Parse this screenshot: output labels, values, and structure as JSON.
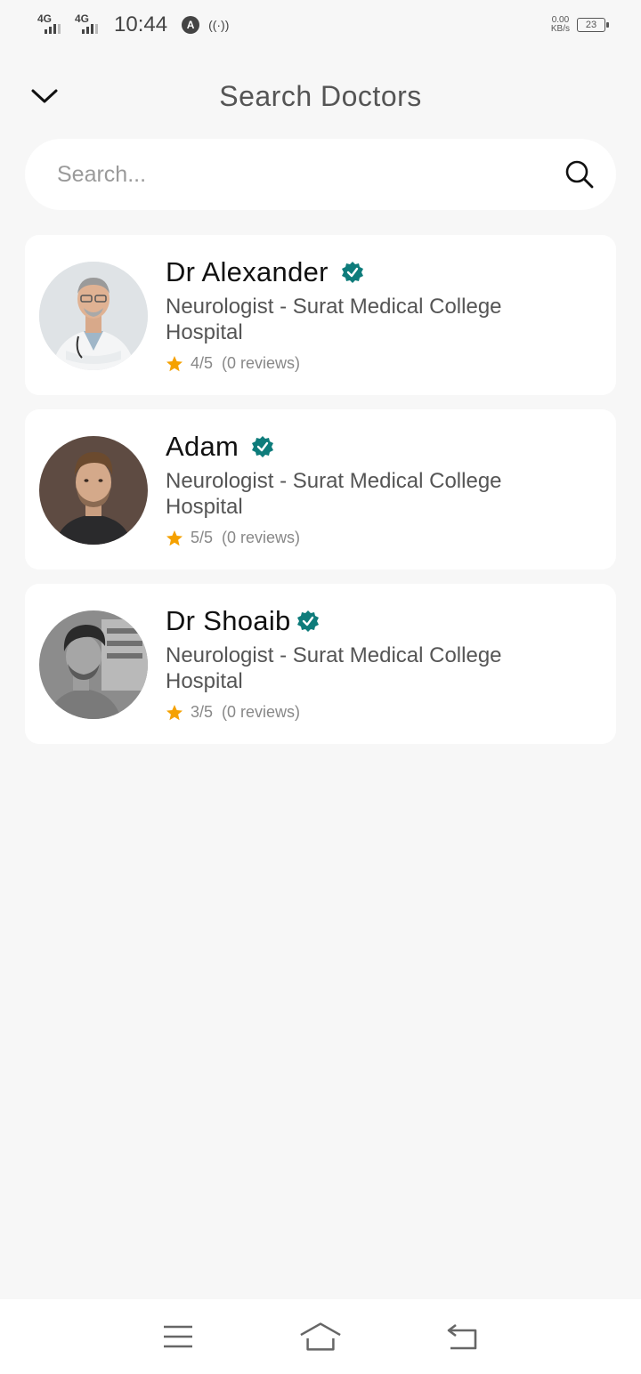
{
  "status_bar": {
    "network_1": "4G",
    "network_2": "4G",
    "time": "10:44",
    "speed_value": "0.00",
    "speed_unit": "KB/s",
    "battery": "23"
  },
  "header": {
    "title": "Search Doctors",
    "back_icon": "chevron-down-icon"
  },
  "search": {
    "placeholder": "Search...",
    "value": "",
    "icon": "search-icon"
  },
  "doctors": [
    {
      "name": "Dr Alexander",
      "verified": true,
      "specialty": "Neurologist - Surat Medical College Hospital",
      "rating": "4/5",
      "reviews": "(0 reviews)"
    },
    {
      "name": "Adam",
      "verified": true,
      "specialty": "Neurologist - Surat Medical College Hospital",
      "rating": "5/5",
      "reviews": "(0 reviews)"
    },
    {
      "name": "Dr Shoaib",
      "verified": true,
      "specialty": "Neurologist - Surat Medical College Hospital",
      "rating": "3/5",
      "reviews": "(0 reviews)"
    }
  ],
  "colors": {
    "verified": "#0e7c7b",
    "star": "#f5a100",
    "background": "#f7f7f7",
    "card": "#ffffff"
  },
  "nav_bar": {
    "menu_icon": "menu-icon",
    "home_icon": "home-icon",
    "back_icon": "back-icon"
  }
}
